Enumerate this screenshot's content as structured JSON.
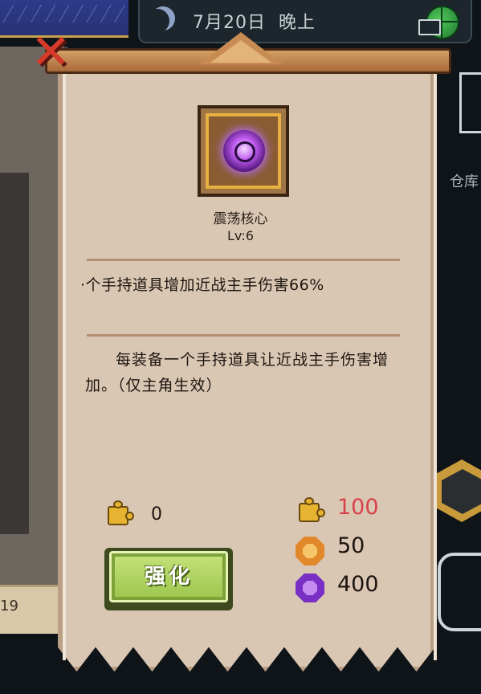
{
  "status_bar": {
    "date": "7月20日",
    "time_of_day": "晚上"
  },
  "background": {
    "left_number": "19",
    "right_label": "仓库"
  },
  "item": {
    "name": "震荡核心",
    "level": "Lv:6",
    "icon": "purple-orb-core-icon",
    "effect": "·个手持道具增加近战主手伤害66%",
    "description": "每装备一个手持道具让近战主手伤害增加。（仅主角生效）"
  },
  "resources": {
    "owned_puzzle": "0",
    "cost_puzzle": "100",
    "cost_orange": "50",
    "cost_purple": "400"
  },
  "actions": {
    "enhance_label": "强化"
  },
  "colors": {
    "insufficient": "#d9424a",
    "parchment": "#dac7b3",
    "button_green": "#9cc64d"
  }
}
